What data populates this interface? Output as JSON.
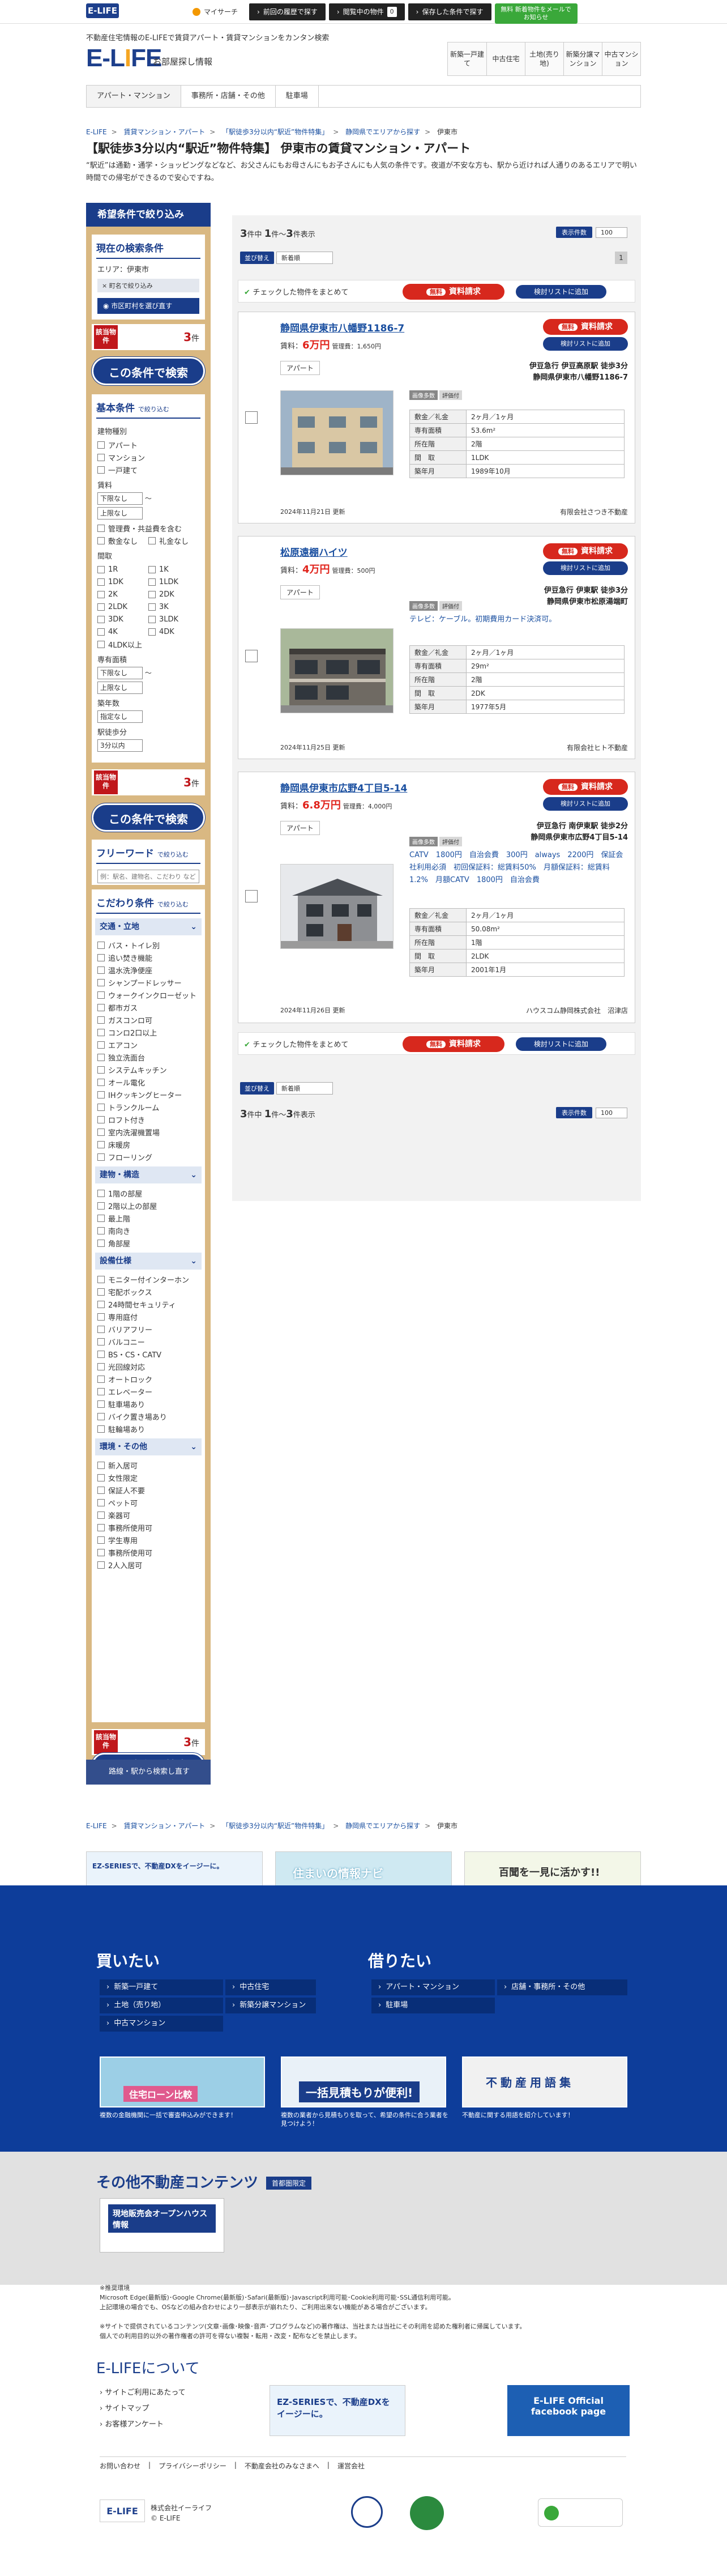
{
  "topbar": {
    "logo": "E-LIFE",
    "mypage": "マイサーチ",
    "history": "前回の履歴で探す",
    "viewed": "閲覧中の物件",
    "viewed_count": "0",
    "saved": "保存した条件で探す",
    "free_reg": "無料 新着物件をメールでお知らせ"
  },
  "header": {
    "tagline": "不動産住宅情報のE-LIFEで賃貸アパート・賃貸マンションをカンタン検索",
    "logo": "E-LIFE",
    "logo_sub": "お部屋探し情報",
    "nav": [
      "新築一戸建て",
      "中古住宅",
      "土地(売り地)",
      "新築分譲マンション",
      "中古マンション"
    ],
    "subnav": [
      "アパート・マンション",
      "事務所・店舗・その他",
      "駐車場"
    ]
  },
  "breadcrumb": [
    "E-LIFE",
    "賃貸マンション・アパート",
    "「駅徒歩3分以内“駅近”物件特集」",
    "静岡県でエリアから探す",
    "伊東市"
  ],
  "page": {
    "title": "【駅徒歩3分以内“駅近”物件特集】 伊東市の賃貸マンション・アパート",
    "desc": "“駅近”は通勤・通学・ショッピングなどなど、お父さんにもお母さんにもお子さんにも人気の条件です。夜道が不安な方も、駅から近ければ人通りのあるエリアで明い時間での帰宅ができるので安心ですね。"
  },
  "sidebar": {
    "head": "希望条件で絞り込み",
    "current_title": "現在の検索条件",
    "area_label": "エリア：伊東市",
    "remove": "× 町名で絞り込み",
    "city_btn": "市区町村を選び直す",
    "hit_label": "該当物件",
    "hit_count": "3",
    "hit_unit": "件",
    "search_btn": "この条件で検索",
    "basic_title": "基本条件",
    "narrow": "で絞り込む",
    "type_label": "建物種別",
    "types": [
      "アパート",
      "マンション",
      "一戸建て"
    ],
    "rent_label": "賃料",
    "rent_min": "下限なし",
    "rent_max": "上限なし",
    "rent_opts": [
      "管理費・共益費を含む",
      "敷金なし",
      "礼金なし"
    ],
    "layout_label": "間取",
    "layouts": [
      "1R",
      "1K",
      "1DK",
      "1LDK",
      "2K",
      "2DK",
      "2LDK",
      "3K",
      "3DK",
      "3LDK",
      "4K",
      "4DK",
      "4LDK以上"
    ],
    "area_size_label": "専有面積",
    "area_min": "下限なし",
    "area_max": "上限なし",
    "age_label": "築年数",
    "age_val": "指定なし",
    "walk_label": "駅徒歩分",
    "walk_val": "3分以内",
    "freeword_title": "フリーワード",
    "freeword_ph": "例：駅名、建物名、こだわり など",
    "kodawari_title": "こだわり条件",
    "group_transport": "交通・立地",
    "transport": [
      "バス・トイレ別",
      "追い焚き機能",
      "温水洗浄便座",
      "シャンプードレッサー",
      "ウォークインクローゼット",
      "都市ガス",
      "ガスコンロ可",
      "コンロ2口以上",
      "エアコン",
      "独立洗面台",
      "システムキッチン",
      "オール電化",
      "IHクッキングヒーター",
      "トランクルーム",
      "ロフト付き",
      "室内洗濯機置場",
      "床暖房",
      "フローリング"
    ],
    "group_building": "建物・構造",
    "building": [
      "1階の部屋",
      "2階以上の部屋",
      "最上階",
      "南向き",
      "角部屋"
    ],
    "group_equipment": "設備仕様",
    "equipment": [
      "モニター付インターホン",
      "宅配ボックス",
      "24時間セキュリティ",
      "専用庭付",
      "バリアフリー",
      "バルコニー",
      "BS・CS・CATV",
      "光回線対応",
      "オートロック",
      "エレベーター",
      "駐車場あり",
      "バイク置き場あり",
      "駐輪場あり"
    ],
    "group_env": "環境・その他",
    "env": [
      "新入居可",
      "女性限定",
      "保証人不要",
      "ペット可",
      "楽器可",
      "事務所使用可",
      "学生専用",
      "事務所使用可",
      "2人入居可"
    ],
    "route_btn": "路線・駅から検索し直す"
  },
  "results": {
    "count_text_pre": "件中",
    "total": "3",
    "from": "1",
    "to": "3",
    "suffix": "件表示",
    "disp_label": "表示件数",
    "disp_val": "100",
    "page": "1",
    "sort_label": "並び替え",
    "sort_val": "新着順",
    "bulk_label": "チェックした物件をまとめて",
    "bulk_request": "資料請求",
    "free": "無料",
    "bulk_list": "検討リストに追加"
  },
  "properties": [
    {
      "name": "静岡県伊東市八幡野1186-7",
      "rent_label": "賃料：",
      "rent": "6万円",
      "fee": "管理費：1,650円",
      "type": "アパート",
      "line": "伊豆急行 伊豆高原駅 徒歩3分",
      "address": "静岡県伊東市八幡野1186-7",
      "tags": [
        "画像多数",
        "評価付"
      ],
      "remark": "",
      "deposit": "2ヶ月／1ヶ月",
      "area": "53.6m²",
      "floor": "2階",
      "layout": "1LDK",
      "built": "1989年10月",
      "updated": "2024年11月21日 更新",
      "company": "有限会社さつき不動産"
    },
    {
      "name": "松原遠棚ハイツ",
      "rent_label": "賃料：",
      "rent": "4万円",
      "fee": "管理費：500円",
      "type": "アパート",
      "line": "伊豆急行 伊東駅 徒歩3分",
      "address": "静岡県伊東市松原湯端町",
      "tags": [
        "画像多数",
        "評価付"
      ],
      "remark": "テレビ：ケーブル。初期費用カード決済可。",
      "deposit": "2ヶ月／1ヶ月",
      "area": "29m²",
      "floor": "2階",
      "layout": "2DK",
      "built": "1977年5月",
      "updated": "2024年11月25日 更新",
      "company": "有限会社ヒト不動産"
    },
    {
      "name": "静岡県伊東市広野4丁目5-14",
      "rent_label": "賃料：",
      "rent": "6.8万円",
      "fee": "管理費：4,000円",
      "type": "アパート",
      "line": "伊豆急行 南伊東駅 徒歩2分",
      "address": "静岡県伊東市広野4丁目5-14",
      "tags": [
        "画像多数",
        "評価付"
      ],
      "remark": "CATV　1800円　自治会費　300円　always　2200円　保証会社利用必須　初回保証料：総賃料50%　月額保証料：総賃料1.2%　月額CATV　1800円　自治会費",
      "deposit": "2ヶ月／1ヶ月",
      "area": "50.08m²",
      "floor": "1階",
      "layout": "2LDK",
      "built": "2001年1月",
      "updated": "2024年11月26日 更新",
      "company": "ハウスコム静岡株式会社　沼津店"
    }
  ],
  "spec_labels": {
    "deposit": "敷金／礼金",
    "area": "専有面積",
    "floor": "所在階",
    "layout": "間　取",
    "built": "築年月"
  },
  "request_btn": "資料請求",
  "list_btn": "検討リストに追加",
  "footer_banners": [
    "EZ-SERIESで、不動産DXをイージーに。",
    "住まいの情報ナビ",
    "百聞を一見に活かす!!"
  ],
  "footer": {
    "buy_title": "買いたい",
    "buy_links": [
      "新築一戸建て",
      "中古住宅",
      "土地（売り地）",
      "新築分譲マンション",
      "中古マンション"
    ],
    "rent_title": "借りたい",
    "rent_links": [
      "アパート・マンション",
      "店舗・事務所・その他",
      "駐車場"
    ],
    "banners": [
      "住宅ローン比較",
      "一括見積もりが便利!",
      "不動産用語集"
    ],
    "banner_desc": [
      "複数の金融機関に一括で審査申込みができます！",
      "複数の業者から見積もりを取って、希望の条件に合う業者を見つけよう！",
      "不動産に関する用語を紹介しています！"
    ],
    "other_title": "その他不動産コンテンツ",
    "other_tag": "首都圏限定",
    "openhouse": "現地販売会オープンハウス情報",
    "about_title": "E-LIFEについて",
    "about_links": [
      "サイトご利用にあたって",
      "サイトマップ",
      "お客様アンケート"
    ],
    "bottom_links": [
      "お問い合わせ",
      "プライバシーポリシー",
      "不動産会社のみなさまへ",
      "運営会社"
    ],
    "company": "株式会社イーライフ",
    "copyright": "© E-LIFE",
    "fb": "E-LIFE Official facebook page",
    "small_print": "※推奨環境\nMicrosoft Edge(最新版)･Google Chrome(最新版)･Safari(最新版)･Javascript利用可能･Cookie利用可能･SSL通信利用可能。\n上記環境の場合でも、OSなどの組み合わせにより一部表示が崩れたり、ご利用出来ない機能がある場合がございます。\n\n※サイトで提供されているコンテンツ(文章･画像･映像･音声･プログラムなど)の著作権は、当社または当社にその利用を認めた権利者に帰属しています。\n個人での利用目的以外の著作権者の許可を得ない複製・転用・改変・配布などを禁止します。"
  }
}
